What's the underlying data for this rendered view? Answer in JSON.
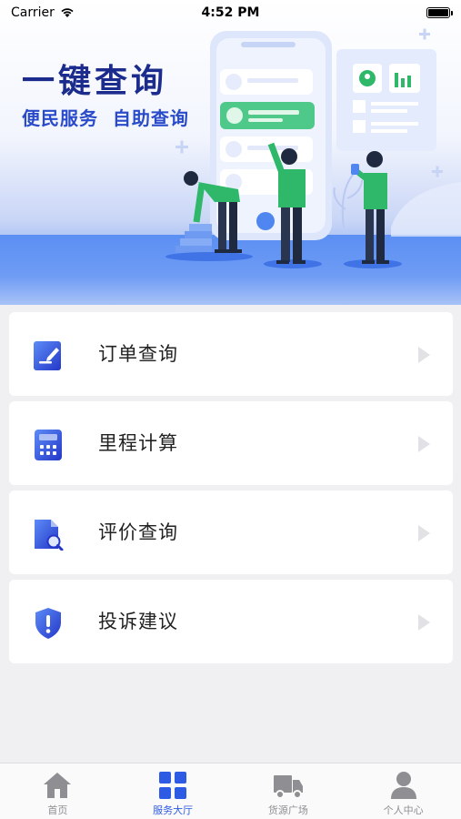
{
  "status_bar": {
    "carrier": "Carrier",
    "time": "4:52 PM"
  },
  "banner": {
    "title": "一键查询",
    "subtitle": "便民服务  自助查询"
  },
  "menu": {
    "items": [
      {
        "label": "订单查询",
        "icon": "order-edit-icon"
      },
      {
        "label": "里程计算",
        "icon": "calculator-icon"
      },
      {
        "label": "评价查询",
        "icon": "document-search-icon"
      },
      {
        "label": "投诉建议",
        "icon": "shield-alert-icon"
      }
    ]
  },
  "tabs": [
    {
      "label": "首页",
      "icon": "home-icon",
      "active": false
    },
    {
      "label": "服务大厅",
      "icon": "grid-icon",
      "active": true
    },
    {
      "label": "货源广场",
      "icon": "truck-icon",
      "active": false
    },
    {
      "label": "个人中心",
      "icon": "person-icon",
      "active": false
    }
  ],
  "colors": {
    "accent": "#2d5be3",
    "title": "#1c2c8c",
    "inactive_tab": "#8e8e93",
    "figure_green": "#2fb86a"
  }
}
